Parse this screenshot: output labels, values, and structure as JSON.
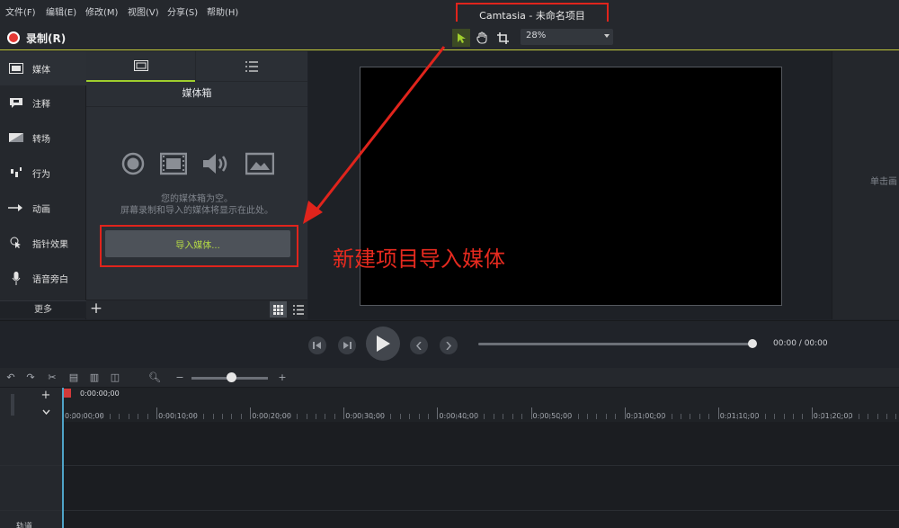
{
  "menu": [
    "文件(F)",
    "编辑(E)",
    "修改(M)",
    "视图(V)",
    "分享(S)",
    "帮助(H)"
  ],
  "window_title": "Camtasia - 未命名项目",
  "record_label": "录制(R)",
  "zoom_level": "28%",
  "sidebar": {
    "items": [
      {
        "label": "媒体",
        "icon": "film-icon"
      },
      {
        "label": "注释",
        "icon": "annotation-icon"
      },
      {
        "label": "转场",
        "icon": "transition-icon"
      },
      {
        "label": "行为",
        "icon": "behavior-icon"
      },
      {
        "label": "动画",
        "icon": "animation-icon"
      },
      {
        "label": "指针效果",
        "icon": "cursor-effect-icon"
      },
      {
        "label": "语音旁白",
        "icon": "microphone-icon"
      }
    ],
    "more_label": "更多"
  },
  "media_bin": {
    "title": "媒体箱",
    "empty_line1": "您的媒体箱为空。",
    "empty_line2": "屏幕录制和导入的媒体将显示在此处。",
    "import_label": "导入媒体..."
  },
  "annotation_text": "新建项目导入媒体",
  "properties_hint": "单击画",
  "playback": {
    "time": "00:00 / 00:00"
  },
  "timeline": {
    "playhead_time": "0:00:00;00",
    "ticks": [
      "0:00:00;00",
      "0:00:10;00",
      "0:00:20;00",
      "0:00:30;00",
      "0:00:40;00",
      "0:00:50;00",
      "0:01:00;00",
      "0:01:10;00",
      "0:01:20;00"
    ],
    "track_label": "轨道"
  },
  "colors": {
    "accent": "#9fce2d",
    "highlight_box": "#e0241c",
    "record_red": "#e53935",
    "playhead": "#4fa3c7"
  }
}
